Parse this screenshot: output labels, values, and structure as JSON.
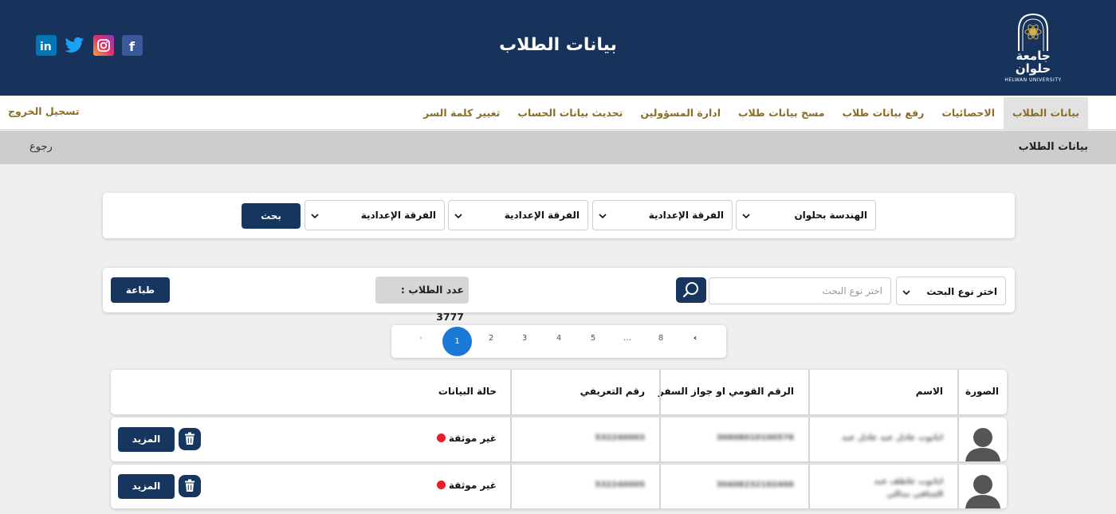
{
  "header": {
    "title": "بيانات الطلاب",
    "logo": {
      "arabic": "جامعة حلوان",
      "english": "HELWAN UNIVERSITY"
    },
    "social": [
      {
        "name": "facebook-icon",
        "color": "#3b5998"
      },
      {
        "name": "instagram-icon",
        "color": "#e1306c"
      },
      {
        "name": "twitter-icon",
        "color": "#1da1f2"
      },
      {
        "name": "linkedin-icon",
        "color": "#0077b5"
      }
    ]
  },
  "nav": {
    "items": [
      {
        "label": "بيانات الطلاب",
        "active": true
      },
      {
        "label": "الاحصائيات"
      },
      {
        "label": "رفع بيانات طلاب"
      },
      {
        "label": "مسح بيانات طلاب"
      },
      {
        "label": "ادارة المسؤولين"
      },
      {
        "label": "تحديث بيانات الحساب"
      },
      {
        "label": "تغيير كلمة السر"
      }
    ],
    "logout": "تسجيل الخروج"
  },
  "subbar": {
    "title": "بيانات الطلاب",
    "back": "رجوع"
  },
  "filters": {
    "faculty": "الهندسة بحلوان",
    "level_1": "الفرقة الإعدادية",
    "level_2": "الفرقة الإعدادية",
    "level_3": "الفرقة الإعدادية",
    "search_button": "بحث"
  },
  "search": {
    "type_select": "اختر نوع البحث",
    "placeholder": "اختر نوع البحث",
    "count_label": "عدد الطلاب : 3777",
    "print_button": "طباعة"
  },
  "pagination": {
    "prev": "‹",
    "pages": [
      "8",
      "…",
      "5",
      "4",
      "3",
      "2",
      "1"
    ],
    "current": "1",
    "next": "›"
  },
  "table": {
    "headers": {
      "photo": "الصورة",
      "name": "الاسم",
      "national_id": "الرقم القومي او جواز السفر",
      "code": "رقم التعريفي",
      "status": "حالة البيانات"
    },
    "rows": [
      {
        "name": "ابانوب عادل عبد عادل عبد",
        "national_id": "30608010100578",
        "code": "532240003",
        "status": "غير موثقة",
        "more": "المزيد"
      },
      {
        "name": "ابانوب عاطف عبد الشافي مدالي",
        "national_id": "30408232102466",
        "code": "532240005",
        "status": "غير موثقة",
        "more": "المزيد"
      }
    ]
  },
  "colors": {
    "header_bg": "#17335c",
    "nav_text": "#8d6d26",
    "button_bg": "#16365f",
    "page_active": "#1a78d6",
    "status_dot": "#e5202b"
  }
}
